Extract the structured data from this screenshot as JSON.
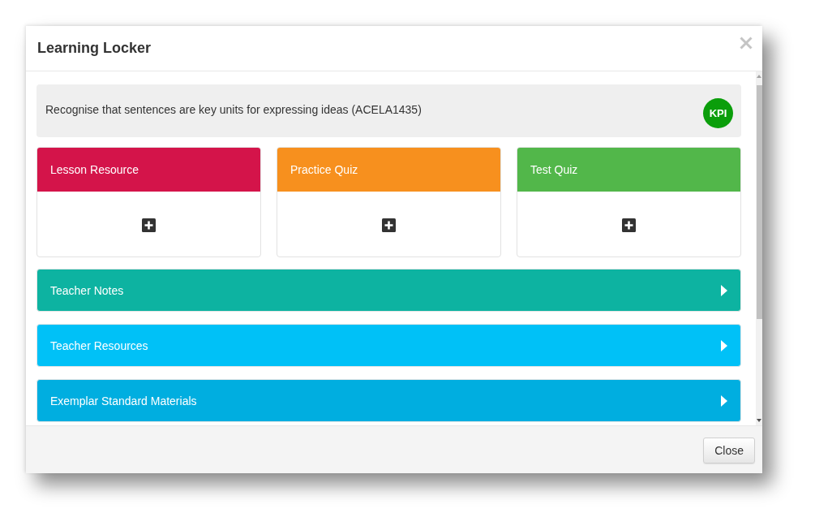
{
  "dialog": {
    "title": "Learning Locker"
  },
  "banner": {
    "text": "Recognise that sentences are key units for expressing ideas (ACELA1435)",
    "badge": "KPI"
  },
  "cards": [
    {
      "title": "Lesson Resource",
      "color": "#d4144a"
    },
    {
      "title": "Practice Quiz",
      "color": "#f7901e"
    },
    {
      "title": "Test Quiz",
      "color": "#52b74a"
    }
  ],
  "sections": [
    {
      "title": "Teacher Notes",
      "color": "#0db3a1",
      "expanded": false
    },
    {
      "title": "Teacher Resources",
      "color": "#00c1f7",
      "expanded": false
    },
    {
      "title": "Exemplar Standard Materials",
      "color": "#00aee0",
      "expanded": false
    }
  ],
  "footer": {
    "buttons": [
      "Close"
    ]
  }
}
